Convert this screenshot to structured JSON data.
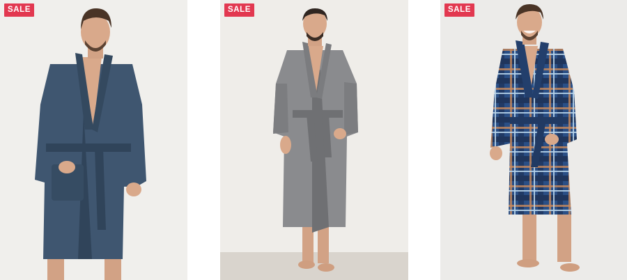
{
  "products": [
    {
      "badge": "SALE",
      "image": "man-in-navy-fleece-robe",
      "bg": "#f0efec",
      "robe_color": "#3f5670",
      "robe_dark": "#30445a"
    },
    {
      "badge": "SALE",
      "image": "man-in-grey-quilted-robe",
      "bg": "#efede9",
      "robe_color": "#8a8b8e",
      "robe_dark": "#6f7073"
    },
    {
      "badge": "SALE",
      "image": "man-in-blue-plaid-robe",
      "bg": "#ecebe9",
      "robe_color": "#2a4f86",
      "robe_dark": "#1f355c"
    }
  ],
  "colors": {
    "badge_bg": "#e23850",
    "badge_text": "#ffffff",
    "skin": "#d9a98b",
    "hair": "#4a3426"
  }
}
